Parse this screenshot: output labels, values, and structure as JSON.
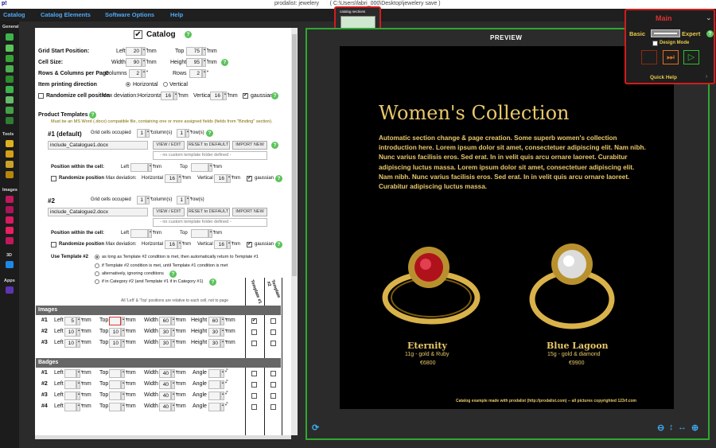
{
  "titlebar": {
    "logo": "p!",
    "title": "prodalist: jewelery       ( C:\\Users\\fabri_000\\Desktop\\jewelery save )"
  },
  "menu": [
    "Catalog",
    "Catalog Elements",
    "Software Options",
    "Help"
  ],
  "sidebar": {
    "general": "General",
    "tools": "Tools",
    "images": "Images",
    "three_d": "3D",
    "apps": "Apps"
  },
  "catalog": {
    "title": "Catalog",
    "grid_start": {
      "label": "Grid Start Position:",
      "left_label": "Left",
      "left": "20",
      "top_label": "Top",
      "top": "75",
      "unit": "mm"
    },
    "cell_size": {
      "label": "Cell Size:",
      "width_label": "Width",
      "width": "90",
      "height_label": "Height",
      "height": "95",
      "unit": "mm"
    },
    "rows_cols": {
      "label": "Rows & Columns per Page",
      "columns_label": "Columns",
      "columns": "2",
      "rows_label": "Rows",
      "rows": "2"
    },
    "direction": {
      "label": "Item printing direction",
      "horizontal": "Horizontal",
      "vertical": "Vertical"
    },
    "randomize": {
      "label": "Randomize cell position",
      "max_dev": "Max deviation:",
      "horizontal_label": "Horizontal",
      "horizontal": "16",
      "vertical_label": "Vertical",
      "vertical": "16",
      "unit": "mm",
      "gaussian": "gaussian"
    }
  },
  "templates": {
    "header": "Product Templates",
    "note": "Must be an MS Word (.docx) compatible file, containing one or more assigned fields (fields from \"Binding\" section).",
    "items": [
      {
        "name": "#1 (default)",
        "occupied_label": "Grid cells occupied",
        "cols": "1",
        "cols_label": "column(s)",
        "rows": "1",
        "rows_label": "row(s)",
        "file": "include_Catalogue1.docx",
        "view": "VIEW / EDIT",
        "reset": "RESET to DEFAULT",
        "import": "IMPORT NEW",
        "folder": "- no custom template folder defined -",
        "pos_label": "Position within the cell:",
        "left_label": "Left",
        "top_label": "Top",
        "unit": "mm",
        "rand_label": "Randomize position",
        "max_dev": "Max deviation:",
        "hz_label": "Horizontal",
        "hz": "16",
        "vt_label": "Vertical",
        "vt": "16",
        "gaussian": "gaussian"
      },
      {
        "name": "#2",
        "occupied_label": "Grid cells occupied",
        "cols": "1",
        "cols_label": "column(s)",
        "rows": "1",
        "rows_label": "row(s)",
        "file": "include_Catalogue2.docx",
        "view": "VIEW / EDIT",
        "reset": "RESET to DEFAULT",
        "import": "IMPORT NEW",
        "folder": "- no custom template folder defined -",
        "pos_label": "Position within the cell:",
        "left_label": "Left",
        "top_label": "Top",
        "unit": "mm",
        "rand_label": "Randomize position",
        "max_dev": "Max deviation:",
        "hz_label": "Horizontal",
        "hz": "16",
        "vt_label": "Vertical",
        "vt": "16",
        "gaussian": "gaussian"
      }
    ],
    "use2": {
      "label": "Use Template #2",
      "options": [
        "as long as Template #2 condition is met, then automatically return to Template #1",
        "if Template #2 condition is met, until Template #1 condition is met",
        "alternatively, ignoring conditions",
        "if in Category #2 (and Template #1 if in Category #1)"
      ]
    },
    "relnote": "All 'Left' & 'Top' positions are relative to each cell, not to page",
    "col1": "Template #1",
    "col2": "Template #2"
  },
  "images": {
    "header": "Images",
    "rows": [
      {
        "n": "#1",
        "left": "5",
        "top": "",
        "width": "60",
        "height": "60"
      },
      {
        "n": "#2",
        "left": "10",
        "top": "10",
        "width": "30",
        "height": "30"
      },
      {
        "n": "#3",
        "left": "10",
        "top": "10",
        "width": "30",
        "height": "30"
      }
    ],
    "left_label": "Left",
    "top_label": "Top",
    "width_label": "Width",
    "height_label": "Height",
    "unit": "mm"
  },
  "badges": {
    "header": "Badges",
    "rows": [
      {
        "n": "#1",
        "width": "40"
      },
      {
        "n": "#2",
        "width": "40"
      },
      {
        "n": "#3",
        "width": "40"
      },
      {
        "n": "#4",
        "width": "40"
      }
    ],
    "left_label": "Left",
    "top_label": "Top",
    "width_label": "Width",
    "angle_label": "Angle",
    "unit": "mm",
    "deg": "°"
  },
  "preview": {
    "label": "PREVIEW",
    "title": "Women's Collection",
    "body": "Automatic section change & page creation. Some superb women's collection introduction here. Lorem ipsum dolor sit amet, consectetuer adipiscing elit. Nam nibh. Nunc varius facilisis eros. Sed erat. In in velit quis arcu ornare laoreet. Curabitur adipiscing luctus massa. Lorem ipsum dolor sit amet, consectetuer adipiscing elit. Nam nibh. Nunc varius facilisis eros. Sed erat. In in velit quis arcu ornare laoreet. Curabitur adipiscing luctus massa.",
    "products": [
      {
        "name": "Eternity",
        "desc": "11g - gold & Ruby",
        "price": "€6800"
      },
      {
        "name": "Blue Lagoon",
        "desc": "15g - gold & diamond",
        "price": "€9900"
      }
    ],
    "footer": "Catalog example made with prodalist (http://prodalist.com) -- all pictures copyrighted 123rf.com"
  },
  "thumb": {
    "label": "catalog sections"
  },
  "mode": {
    "title": "Main",
    "basic": "Basic",
    "expert": "Expert",
    "design": "Design Mode",
    "quick_help": "Quick Help"
  },
  "colors": {
    "accent": "#4fa8f5",
    "green": "#2fa82f",
    "red": "#d21c1c",
    "gold": "#e9c86a"
  }
}
